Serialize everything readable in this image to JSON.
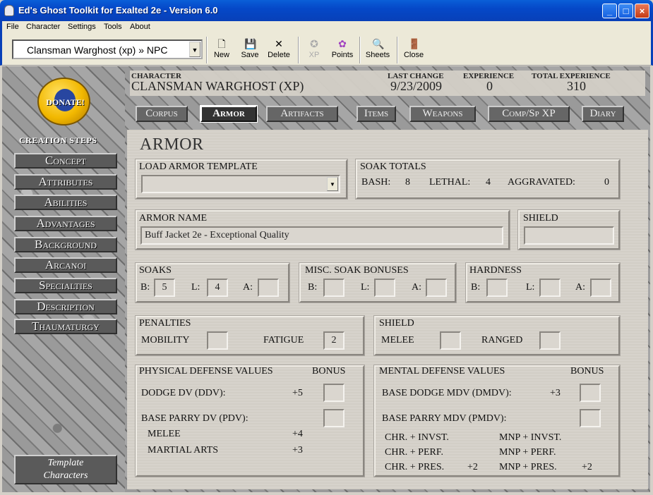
{
  "window": {
    "title": "Ed's Ghost Toolkit for Exalted 2e - Version 6.0",
    "buttons": [
      "_",
      "□",
      "×"
    ]
  },
  "menu": [
    "File",
    "Character",
    "Settings",
    "Tools",
    "About"
  ],
  "toolbar": {
    "character_select": "Clansman Warghost (xp) » NPC",
    "buttons": [
      {
        "label": "New",
        "icon": "new-document-icon"
      },
      {
        "label": "Save",
        "icon": "floppy-disk-icon"
      },
      {
        "label": "Delete",
        "icon": "delete-x-icon"
      },
      {
        "label": "XP",
        "icon": "xp-icon",
        "disabled": true
      },
      {
        "label": "Points",
        "icon": "points-icon"
      },
      {
        "label": "Sheets",
        "icon": "sheets-search-icon"
      },
      {
        "label": "Close",
        "icon": "exit-door-icon"
      }
    ]
  },
  "sidebar": {
    "donate": "DONATE!",
    "creation_steps": "CREATION STEPS",
    "steps": [
      "Concept",
      "Attributes",
      "Abilities",
      "Advantages",
      "Background",
      "Arcanoi",
      "Specialties",
      "Description",
      "Thaumaturgy"
    ],
    "template_characters": [
      "Template",
      "Characters"
    ]
  },
  "header": {
    "character_label": "CHARACTER",
    "character_value": "CLANSMAN WARGHOST (XP)",
    "last_change_label": "LAST CHANGE",
    "last_change_value": "9/23/2009",
    "experience_label": "EXPERIENCE",
    "experience_value": "0",
    "total_experience_label": "TOTAL EXPERIENCE",
    "total_experience_value": "310"
  },
  "tabs": [
    "Corpus",
    "Armor",
    "Artifacts",
    "Items",
    "Weapons",
    "Comp/Sp XP",
    "Diary"
  ],
  "armor": {
    "title": "ARMOR",
    "load_template_label": "LOAD ARMOR TEMPLATE",
    "load_template_value": "",
    "soak_totals_label": "SOAK TOTALS",
    "bash_label": "BASH:",
    "bash_value": "8",
    "lethal_label": "LETHAL:",
    "lethal_value": "4",
    "aggravated_label": "AGGRAVATED:",
    "aggravated_value": "0",
    "armor_name_label": "ARMOR NAME",
    "armor_name_value": "Buff Jacket 2e - Exceptional Quality",
    "shield_label": "SHIELD",
    "shield_value": "",
    "soaks_label": "SOAKS",
    "soaks": {
      "b_label": "B:",
      "b": "5",
      "l_label": "L:",
      "l": "4",
      "a_label": "A:",
      "a": ""
    },
    "misc_label": "MISC. SOAK BONUSES",
    "misc": {
      "b_label": "B:",
      "b": "",
      "l_label": "L:",
      "l": "",
      "a_label": "A:",
      "a": ""
    },
    "hardness_label": "HARDNESS",
    "hardness": {
      "b_label": "B:",
      "b": "",
      "l_label": "L:",
      "l": "",
      "a_label": "A:",
      "a": ""
    },
    "penalties_label": "PENALTIES",
    "mobility_label": "MOBILITY",
    "mobility_value": "",
    "fatigue_label": "FATIGUE",
    "fatigue_value": "2",
    "shield2_label": "SHIELD",
    "melee_label": "MELEE",
    "melee_value": "",
    "ranged_label": "RANGED",
    "ranged_value": "",
    "physical": {
      "label": "PHYSICAL DEFENSE VALUES",
      "bonus_label": "BONUS",
      "dodge_label": "DODGE DV (DDV):",
      "dodge_value": "+5",
      "parry_label": "BASE PARRY DV (PDV):",
      "melee_label": "MELEE",
      "melee_value": "+4",
      "martial_label": "MARTIAL ARTS",
      "martial_value": "+3"
    },
    "mental": {
      "label": "MENTAL DEFENSE VALUES",
      "bonus_label": "BONUS",
      "dodge_label": "BASE DODGE MDV (DMDV):",
      "dodge_value": "+3",
      "parry_label": "BASE PARRY MDV (PMDV):",
      "chr_invst": "CHR. + INVST.",
      "mnp_invst": "MNP + INVST.",
      "chr_perf": "CHR. + PERF.",
      "mnp_perf": "MNP + PERF.",
      "chr_pres": "CHR. + PRES.",
      "chr_pres_value": "+2",
      "mnp_pres": "MNP + PRES.",
      "mnp_pres_value": "+2"
    }
  }
}
